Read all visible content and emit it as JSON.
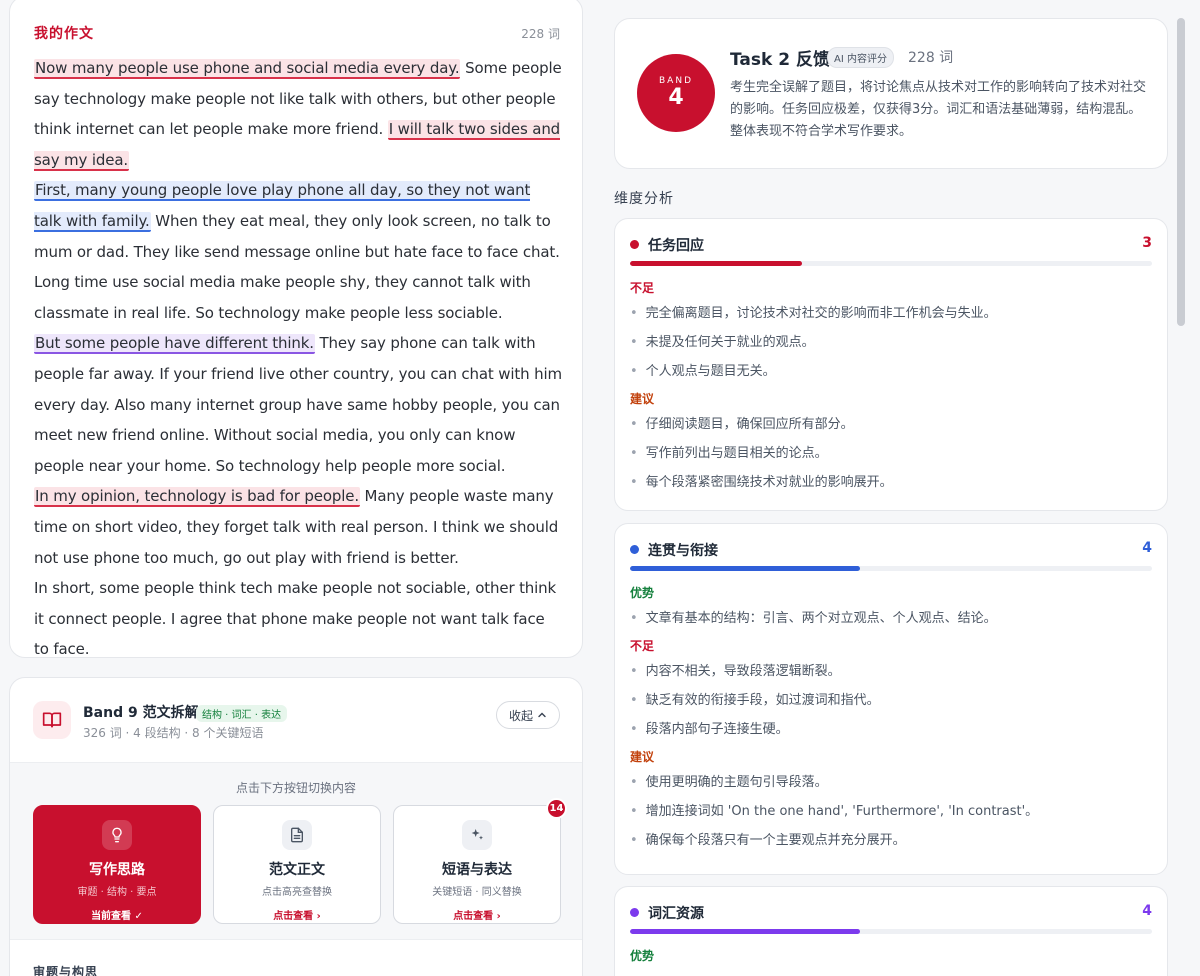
{
  "essay": {
    "title": "我的作文",
    "word_count": "228 词",
    "segments": [
      {
        "text": "Now many people use phone and social media every day.",
        "hl": "red"
      },
      {
        "text": " Some people say technology make people not like talk with others, but other people think internet can let people make more friend. ",
        "hl": ""
      },
      {
        "text": "I will talk two sides and say my idea.",
        "hl": "red"
      },
      {
        "br": true
      },
      {
        "text": "First, many young people love play phone all day, so they not want talk with family.",
        "hl": "blue"
      },
      {
        "text": " When they eat meal, they only look screen, no talk to mum or dad. They like send message online but hate face to face chat. Long time use social media make people shy, they cannot talk with classmate in real life. So technology make people less sociable.",
        "hl": ""
      },
      {
        "br": true
      },
      {
        "text": "But some people have different think.",
        "hl": "purple"
      },
      {
        "text": " They say phone can talk with people far away. If your friend live other country, you can chat with him every day. Also many internet group have same hobby people, you can meet new friend online. Without social media, you only can know people near your home. So technology help people more social.",
        "hl": ""
      },
      {
        "br": true
      },
      {
        "text": "In my opinion, technology is bad for people.",
        "hl": "red"
      },
      {
        "text": " Many people waste many time on short video, they forget talk with real person. I think we should not use phone too much, go out play with friend is better.",
        "hl": ""
      },
      {
        "br": true
      },
      {
        "text": "In short, some people think tech make people not sociable, other think it connect people. I agree that phone make people not want talk face to face.",
        "hl": ""
      }
    ]
  },
  "model_essay": {
    "title": "Band 9 范文拆解",
    "tags": "结构 · 词汇 · 表达",
    "subtitle": "326 词 · 4 段结构 · 8 个关键短语",
    "collapse_label": "收起",
    "switch_hint": "点击下方按钮切换内容",
    "options": [
      {
        "label": "写作思路",
        "sub": "审题 · 结构 · 要点",
        "action": "当前查看 ✓",
        "icon": "lightbulb-icon"
      },
      {
        "label": "范文正文",
        "sub": "点击高亮查替换",
        "action": "点击查看 ›",
        "icon": "document-icon"
      },
      {
        "label": "短语与表达",
        "sub": "关键短语 · 同义替换",
        "action": "点击查看 ›",
        "icon": "sparkle-icon",
        "badge": "14"
      }
    ],
    "section_title": "审题与构思"
  },
  "feedback": {
    "band_word": "BAND",
    "band_score": "4",
    "title": "Task 2 反馈",
    "ai_badge": "AI 内容评分",
    "word_count": "228 词",
    "summary": "考生完全误解了题目，将讨论焦点从技术对工作的影响转向了技术对社交的影响。任务回应极差，仅获得3分。词汇和语法基础薄弱，结构混乱。整体表现不符合学术写作要求。"
  },
  "dimensions_label": "维度分析",
  "dimensions": [
    {
      "name": "任务回应",
      "score": "3",
      "level": 0.33,
      "color": "#c8102e",
      "groups": [
        {
          "type": "bad",
          "title": "不足",
          "items": [
            "完全偏离题目，讨论技术对社交的影响而非工作机会与失业。",
            "未提及任何关于就业的观点。",
            "个人观点与题目无关。"
          ]
        },
        {
          "type": "sug",
          "title": "建议",
          "items": [
            "仔细阅读题目，确保回应所有部分。",
            "写作前列出与题目相关的论点。",
            "每个段落紧密围绕技术对就业的影响展开。"
          ]
        }
      ]
    },
    {
      "name": "连贯与衔接",
      "score": "4",
      "level": 0.44,
      "color": "#2f5fd8",
      "groups": [
        {
          "type": "good",
          "title": "优势",
          "items": [
            "文章有基本的结构：引言、两个对立观点、个人观点、结论。"
          ]
        },
        {
          "type": "bad",
          "title": "不足",
          "items": [
            "内容不相关，导致段落逻辑断裂。",
            "缺乏有效的衔接手段，如过渡词和指代。",
            "段落内部句子连接生硬。"
          ]
        },
        {
          "type": "sug",
          "title": "建议",
          "items": [
            "使用更明确的主题句引导段落。",
            "增加连接词如 'On the one hand', 'Furthermore', 'In contrast'。",
            "确保每个段落只有一个主要观点并充分展开。"
          ]
        }
      ]
    },
    {
      "name": "词汇资源",
      "score": "4",
      "level": 0.44,
      "color": "#7c3aed",
      "groups": [
        {
          "type": "good",
          "title": "优势",
          "items": []
        }
      ]
    }
  ]
}
